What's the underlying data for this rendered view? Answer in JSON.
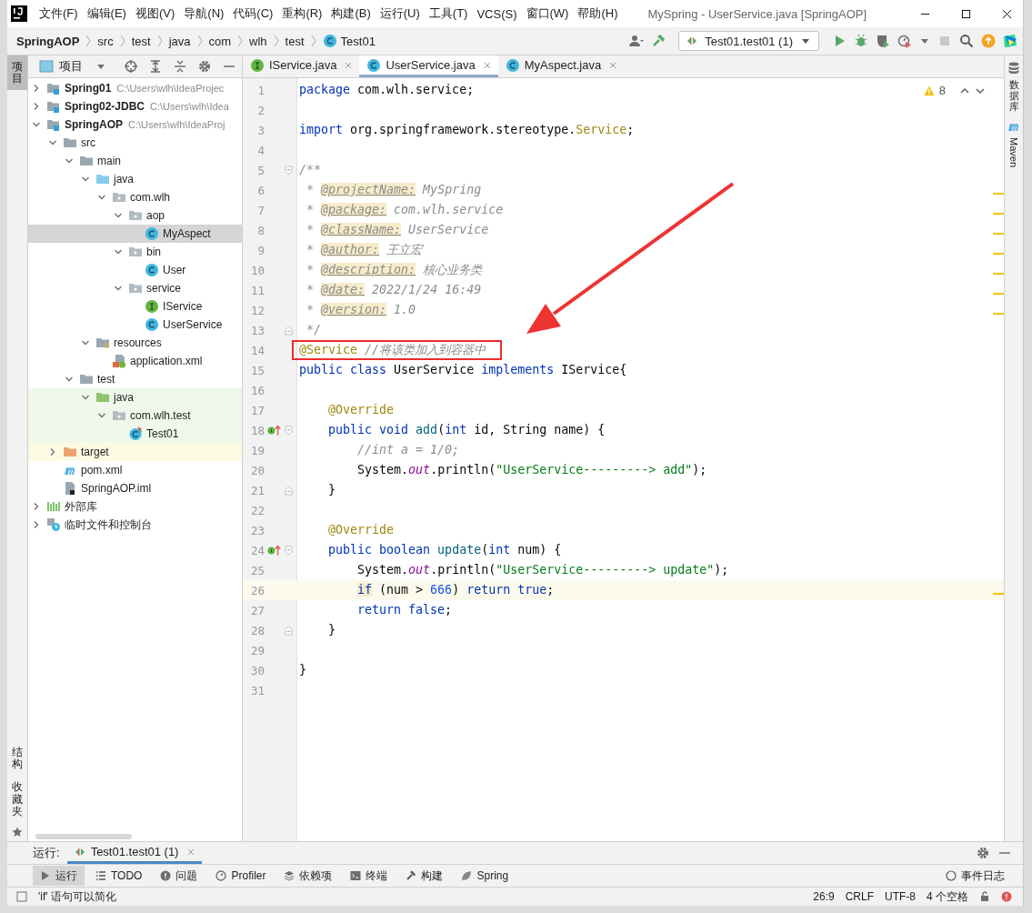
{
  "window": {
    "title": "MySpring - UserService.java [SpringAOP]"
  },
  "menu": [
    "文件(F)",
    "编辑(E)",
    "视图(V)",
    "导航(N)",
    "代码(C)",
    "重构(R)",
    "构建(B)",
    "运行(U)",
    "工具(T)",
    "VCS(S)",
    "窗口(W)",
    "帮助(H)"
  ],
  "breadcrumb": [
    {
      "label": "SpringAOP",
      "kind": "project"
    },
    {
      "label": "src",
      "kind": "folder"
    },
    {
      "label": "test",
      "kind": "folder"
    },
    {
      "label": "java",
      "kind": "folder"
    },
    {
      "label": "com",
      "kind": "folder"
    },
    {
      "label": "wlh",
      "kind": "folder"
    },
    {
      "label": "test",
      "kind": "folder"
    },
    {
      "label": "Test01",
      "kind": "class"
    }
  ],
  "run_config": "Test01.test01 (1)",
  "left_strip": [
    {
      "label": "项目",
      "selected": true
    },
    {
      "label": "结构",
      "selected": false
    },
    {
      "label": "收藏夹",
      "selected": false
    }
  ],
  "project_panel": {
    "title": "项目",
    "tree": [
      {
        "label": "Spring01",
        "kind": "module",
        "path": "C:\\Users\\wlh\\IdeaProjec",
        "expanded": false,
        "selected": false
      },
      {
        "label": "Spring02-JDBC",
        "kind": "module",
        "path": "C:\\Users\\wlh\\Idea",
        "expanded": false,
        "selected": false
      },
      {
        "label": "SpringAOP",
        "kind": "module",
        "path": "C:\\Users\\wlh\\IdeaProj",
        "expanded": true,
        "selected": false,
        "children": [
          {
            "label": "src",
            "kind": "folder",
            "expanded": true,
            "selected": false,
            "children": [
              {
                "label": "main",
                "kind": "folder",
                "expanded": true,
                "selected": false,
                "children": [
                  {
                    "label": "java",
                    "kind": "srcfolder",
                    "expanded": true,
                    "selected": false,
                    "children": [
                      {
                        "label": "com.wlh",
                        "kind": "package",
                        "expanded": true,
                        "selected": false,
                        "children": [
                          {
                            "label": "aop",
                            "kind": "package",
                            "expanded": true,
                            "selected": false,
                            "children": [
                              {
                                "label": "MyAspect",
                                "kind": "class",
                                "selected": true
                              }
                            ]
                          },
                          {
                            "label": "bin",
                            "kind": "package",
                            "expanded": true,
                            "selected": false,
                            "children": [
                              {
                                "label": "User",
                                "kind": "class",
                                "selected": false
                              }
                            ]
                          },
                          {
                            "label": "service",
                            "kind": "package",
                            "expanded": true,
                            "selected": false,
                            "children": [
                              {
                                "label": "IService",
                                "kind": "interface",
                                "selected": false
                              },
                              {
                                "label": "UserService",
                                "kind": "class",
                                "selected": false
                              }
                            ]
                          }
                        ]
                      }
                    ]
                  },
                  {
                    "label": "resources",
                    "kind": "resfolder",
                    "expanded": true,
                    "selected": false,
                    "children": [
                      {
                        "label": "application.xml",
                        "kind": "xml",
                        "selected": false
                      }
                    ]
                  }
                ]
              },
              {
                "label": "test",
                "kind": "folder",
                "expanded": true,
                "selected": false,
                "children": [
                  {
                    "label": "java",
                    "kind": "testfolder",
                    "test_source": true,
                    "expanded": true,
                    "selected": false,
                    "children": [
                      {
                        "label": "com.wlh.test",
                        "kind": "package",
                        "test_source": true,
                        "expanded": true,
                        "selected": false,
                        "children": [
                          {
                            "label": "Test01",
                            "kind": "testclass",
                            "test_source": true,
                            "selected": false
                          }
                        ]
                      }
                    ]
                  }
                ]
              }
            ]
          },
          {
            "label": "target",
            "kind": "target",
            "excluded": true,
            "expanded": false,
            "selected": false
          },
          {
            "label": "pom.xml",
            "kind": "maven",
            "selected": false
          },
          {
            "label": "SpringAOP.iml",
            "kind": "iml",
            "selected": false
          }
        ]
      },
      {
        "label": "外部库",
        "kind": "library",
        "expanded": false,
        "selected": false
      },
      {
        "label": "临时文件和控制台",
        "kind": "scratch",
        "expanded": false,
        "selected": false
      }
    ]
  },
  "editor_tabs": [
    {
      "label": "IService.java",
      "kind": "interface",
      "selected": false
    },
    {
      "label": "UserService.java",
      "kind": "class",
      "selected": true
    },
    {
      "label": "MyAspect.java",
      "kind": "class",
      "selected": false
    }
  ],
  "warnings": "8",
  "code": [
    {
      "n": "1",
      "tokens": [
        {
          "kind": "kw",
          "text": "package"
        },
        {
          "kind": "p",
          "text": " com.wlh.service;"
        }
      ]
    },
    {
      "n": "2"
    },
    {
      "n": "3",
      "tokens": [
        {
          "kind": "kw",
          "text": "import"
        },
        {
          "kind": "p",
          "text": " org.springframework.stereotype."
        },
        {
          "kind": "ann",
          "text": "Service"
        },
        {
          "kind": "p",
          "text": ";"
        }
      ]
    },
    {
      "n": "4"
    },
    {
      "n": "5",
      "fold_start": true,
      "tokens": [
        {
          "kind": "cmt",
          "text": "/**"
        }
      ]
    },
    {
      "n": "6",
      "stripe": true,
      "tokens": [
        {
          "kind": "cmt",
          "text": " *"
        },
        {
          "kind": "tag",
          "text": " @projectName:"
        },
        {
          "kind": "cmt",
          "text": " MySpring"
        }
      ]
    },
    {
      "n": "7",
      "stripe": true,
      "tokens": [
        {
          "kind": "cmt",
          "text": " *"
        },
        {
          "kind": "tag",
          "text": " @package:"
        },
        {
          "kind": "cmt",
          "text": " com.wlh.service"
        }
      ]
    },
    {
      "n": "8",
      "stripe": true,
      "tokens": [
        {
          "kind": "cmt",
          "text": " *"
        },
        {
          "kind": "tag",
          "text": " @className:"
        },
        {
          "kind": "cmt",
          "text": " UserService"
        }
      ]
    },
    {
      "n": "9",
      "stripe": true,
      "tokens": [
        {
          "kind": "cmt",
          "text": " *"
        },
        {
          "kind": "tag",
          "text": " @author:"
        },
        {
          "kind": "cmt",
          "text": " 王立宏"
        }
      ]
    },
    {
      "n": "10",
      "stripe": true,
      "tokens": [
        {
          "kind": "cmt",
          "text": " *"
        },
        {
          "kind": "tag",
          "text": " @description:"
        },
        {
          "kind": "cmt",
          "text": " 核心业务类"
        }
      ]
    },
    {
      "n": "11",
      "stripe": true,
      "tokens": [
        {
          "kind": "cmt",
          "text": " *"
        },
        {
          "kind": "tag",
          "text": " @date:"
        },
        {
          "kind": "cmt",
          "text": " 2022/1/24 16:49"
        }
      ]
    },
    {
      "n": "12",
      "stripe": true,
      "tokens": [
        {
          "kind": "cmt",
          "text": " *"
        },
        {
          "kind": "tag",
          "text": " @version:"
        },
        {
          "kind": "cmt",
          "text": " 1.0"
        }
      ]
    },
    {
      "n": "13",
      "fold_end": true,
      "tokens": [
        {
          "kind": "cmt",
          "text": " */"
        }
      ]
    },
    {
      "n": "14",
      "boxed": true,
      "tokens": [
        {
          "kind": "ann",
          "text": "@Service"
        },
        {
          "kind": "cmt",
          "text": " //将该类加入到容器中"
        }
      ]
    },
    {
      "n": "15",
      "tokens": [
        {
          "kind": "kw",
          "text": "public class"
        },
        {
          "kind": "p",
          "text": " UserService "
        },
        {
          "kind": "kw",
          "text": "implements"
        },
        {
          "kind": "p",
          "text": " IService{"
        }
      ]
    },
    {
      "n": "16"
    },
    {
      "n": "17",
      "tokens": [
        {
          "kind": "ann",
          "text": "    @Override"
        }
      ]
    },
    {
      "n": "18",
      "implements_marker": true,
      "fold_start": true,
      "tokens": [
        {
          "kind": "kw",
          "text": "    public void"
        },
        {
          "kind": "fn",
          "text": " add"
        },
        {
          "kind": "p",
          "text": "("
        },
        {
          "kind": "kw",
          "text": "int"
        },
        {
          "kind": "p",
          "text": " id, String name) {"
        }
      ]
    },
    {
      "n": "19",
      "tokens": [
        {
          "kind": "cmt",
          "text": "        //int a = 1/0;"
        }
      ]
    },
    {
      "n": "20",
      "tokens": [
        {
          "kind": "p",
          "text": "        System."
        },
        {
          "kind": "field",
          "text": "out"
        },
        {
          "kind": "p",
          "text": ".println("
        },
        {
          "kind": "str",
          "text": "\"UserService---------> add\""
        },
        {
          "kind": "p",
          "text": ");"
        }
      ]
    },
    {
      "n": "21",
      "fold_end": true,
      "tokens": [
        {
          "kind": "p",
          "text": "    }"
        }
      ]
    },
    {
      "n": "22"
    },
    {
      "n": "23",
      "tokens": [
        {
          "kind": "ann",
          "text": "    @Override"
        }
      ]
    },
    {
      "n": "24",
      "implements_marker": true,
      "fold_start": true,
      "tokens": [
        {
          "kind": "kw",
          "text": "    public boolean"
        },
        {
          "kind": "fn",
          "text": " update"
        },
        {
          "kind": "p",
          "text": "("
        },
        {
          "kind": "kw",
          "text": "int"
        },
        {
          "kind": "p",
          "text": " num) {"
        }
      ]
    },
    {
      "n": "25",
      "tokens": [
        {
          "kind": "p",
          "text": "        System."
        },
        {
          "kind": "field",
          "text": "out"
        },
        {
          "kind": "p",
          "text": ".println("
        },
        {
          "kind": "str",
          "text": "\"UserService---------> update\""
        },
        {
          "kind": "p",
          "text": ");"
        }
      ]
    },
    {
      "n": "26",
      "current": true,
      "stripe": true,
      "tokens": [
        {
          "kind": "kwhl",
          "text": "        if"
        },
        {
          "kind": "p",
          "text": " (num > "
        },
        {
          "kind": "num",
          "text": "666"
        },
        {
          "kind": "p",
          "text": ") "
        },
        {
          "kind": "kw",
          "text": "return true"
        },
        {
          "kind": "p",
          "text": ";"
        }
      ]
    },
    {
      "n": "27",
      "tokens": [
        {
          "kind": "kw",
          "text": "        return false"
        },
        {
          "kind": "p",
          "text": ";"
        }
      ]
    },
    {
      "n": "28",
      "fold_end": true,
      "tokens": [
        {
          "kind": "p",
          "text": "    }"
        }
      ]
    },
    {
      "n": "29"
    },
    {
      "n": "30",
      "tokens": [
        {
          "kind": "p",
          "text": "}"
        }
      ]
    },
    {
      "n": "31"
    }
  ],
  "right_strip": [
    {
      "label": "数据库",
      "kind": "database"
    },
    {
      "label": "Maven",
      "kind": "maven"
    }
  ],
  "run_bar": {
    "label": "运行:",
    "tab": "Test01.test01 (1)"
  },
  "tool_buttons": [
    {
      "label": "运行",
      "kind": "run",
      "selected": true
    },
    {
      "label": "TODO",
      "kind": "list",
      "selected": false
    },
    {
      "label": "问题",
      "kind": "problem",
      "selected": false
    },
    {
      "label": "Profiler",
      "kind": "profiler",
      "selected": false
    },
    {
      "label": "依赖项",
      "kind": "layers",
      "selected": false
    },
    {
      "label": "终端",
      "kind": "terminal",
      "selected": false
    },
    {
      "label": "构建",
      "kind": "hammer",
      "selected": false
    },
    {
      "label": "Spring",
      "kind": "leaf",
      "selected": false
    }
  ],
  "event_log": "事件日志",
  "status_bar": {
    "message": "'if' 语句可以简化",
    "items": [
      "26:9",
      "CRLF",
      "UTF-8",
      "4 个空格"
    ]
  }
}
